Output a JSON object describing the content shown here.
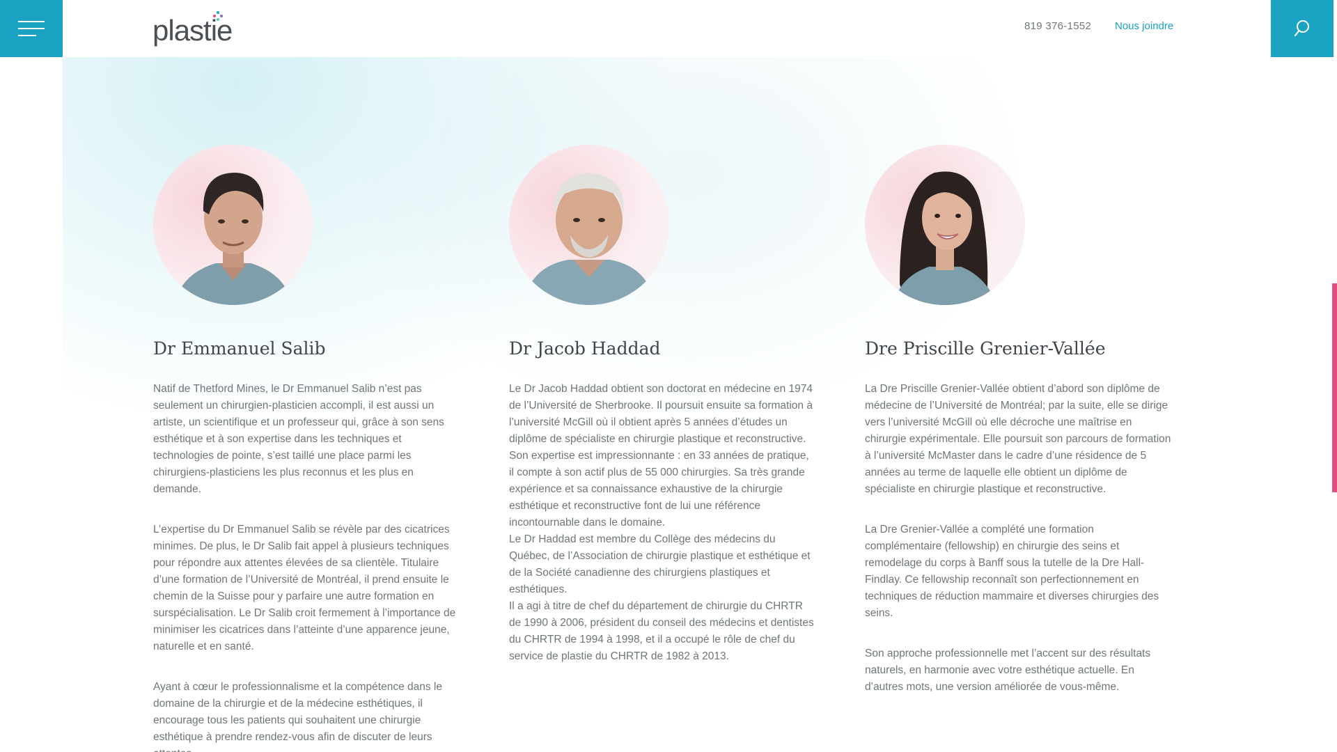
{
  "header": {
    "logo_text": "plastie",
    "phone": "819 376-1552",
    "contact_label": "Nous joindre"
  },
  "icons": {
    "menu": "hamburger-icon",
    "search": "search-icon"
  },
  "colors": {
    "accent": "#1aa3c3",
    "pink": "#e24f80",
    "text": "#6f7678",
    "heading": "#3f4448"
  },
  "doctors": [
    {
      "name": "Dr Emmanuel Salib",
      "paragraphs": [
        "Natif de Thetford Mines, le Dr Emmanuel Salib n’est pas seulement un chirurgien-plasticien accompli, il est aussi un artiste, un scientifique et un professeur qui, grâce à son sens esthétique et à son expertise dans les techniques et technologies de pointe, s’est taillé une place parmi les chirurgiens-plasticiens les plus reconnus et les plus en demande.",
        "L’expertise du Dr Emmanuel Salib se révèle par des cicatrices minimes. De plus, le Dr Salib fait appel à plusieurs techniques pour répondre aux attentes élevées de sa clientèle. Titulaire d’une formation de l’Université de Montréal, il prend ensuite le chemin de la Suisse pour y parfaire une autre formation en surspécialisation. Le Dr Salib croit fermement à l’importance de minimiser les cicatrices dans l’atteinte d’une apparence jeune, naturelle et en santé.",
        "Ayant à cœur le professionnalisme et la compétence dans le domaine de la chirurgie et de la médecine esthétiques, il encourage tous les patients qui souhaitent une chirurgie esthétique à prendre rendez-vous afin de discuter de leurs attentes."
      ]
    },
    {
      "name": "Dr Jacob Haddad",
      "paragraphs": [
        "Le Dr Jacob Haddad obtient son doctorat en médecine en 1974 de l’Université de Sherbrooke. Il poursuit ensuite sa formation à l’université McGill où il obtient après 5 années d’études un diplôme de spécialiste en chirurgie plastique et reconstructive.",
        "Son expertise est impressionnante : en 33 années de pratique, il compte à son actif plus de 55 000 chirurgies. Sa très grande expérience et sa connaissance exhaustive de la chirurgie esthétique et reconstructive font de lui une référence incontournable dans le domaine.",
        "Le Dr Haddad est membre du Collège des médecins du Québec, de l’Association de chirurgie plastique et esthétique et de la Société canadienne des chirurgiens plastiques et esthétiques.",
        "Il a agi à titre de chef du département de chirurgie du CHRTR de 1990 à 2006, président du conseil des médecins et dentistes du CHRTR de 1994 à 1998, et il a occupé le rôle de chef du service de plastie du CHRTR de 1982 à 2013."
      ]
    },
    {
      "name": "Dre Priscille Grenier-Vallée",
      "paragraphs": [
        "La Dre Priscille Grenier-Vallée obtient d’abord son diplôme de médecine de l’Université de Montréal; par la suite, elle se dirige vers l’université McGill où elle décroche une maîtrise en chirurgie expérimentale. Elle poursuit son parcours de formation à l’université McMaster dans le cadre d’une résidence de 5 années au terme de laquelle elle obtient un diplôme de spécialiste en chirurgie plastique et reconstructive.",
        "La Dre Grenier-Vallée a complété une formation complémentaire (fellowship) en chirurgie des seins et remodelage du corps à Banff sous la tutelle de la Dre Hall-Findlay. Ce fellowship reconnaît son perfectionnement en techniques de réduction mammaire et diverses chirurgies des seins.",
        "Son approche professionnelle met l’accent sur des résultats naturels, en harmonie avec votre esthétique actuelle. En d’autres mots, une version améliorée de vous-même."
      ]
    }
  ]
}
